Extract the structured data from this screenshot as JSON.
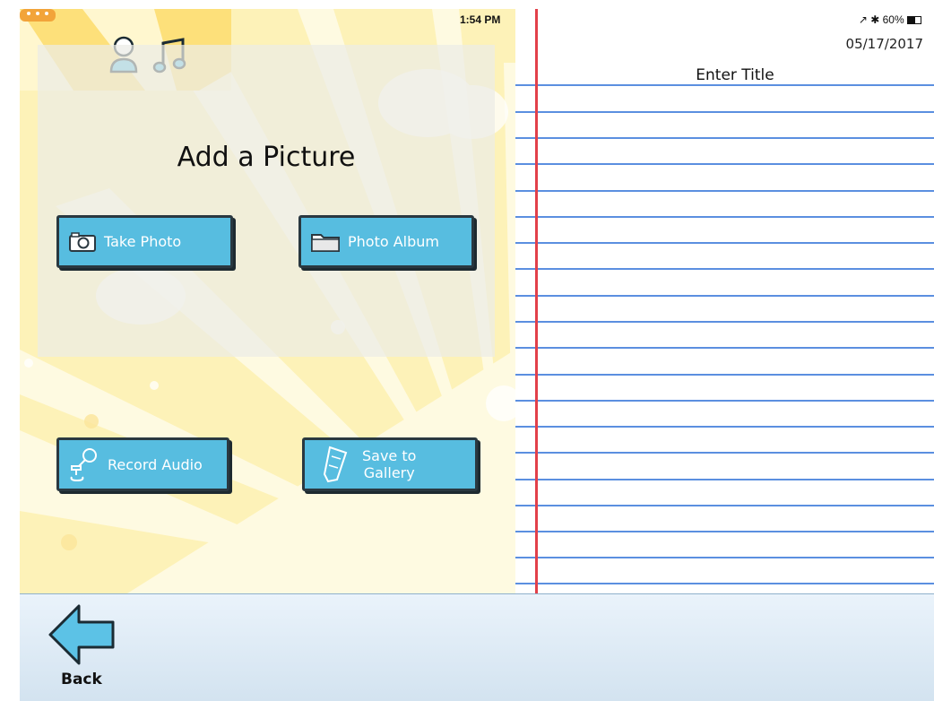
{
  "status_bar": {
    "time": "1:54 PM",
    "right_indicators": "↗ ✱ 60%",
    "battery_icon": "battery-icon"
  },
  "top_tab": {
    "icons": [
      "user-icon",
      "music-note-icon"
    ]
  },
  "left_panel": {
    "heading": "Add a Picture",
    "take_photo_label": "Take Photo",
    "photo_album_label": "Photo Album",
    "record_audio_label": "Record Audio",
    "save_gallery_line1": "Save to",
    "save_gallery_line2": "Gallery"
  },
  "notebook": {
    "date": "05/17/2017",
    "title_placeholder": "Enter Title"
  },
  "bottom_bar": {
    "back_label": "Back"
  },
  "colors": {
    "button_blue": "#57bde0",
    "margin_red": "#e2404a",
    "rule_blue": "#5b8fe0",
    "background_yellow": "#fdf2b8"
  }
}
